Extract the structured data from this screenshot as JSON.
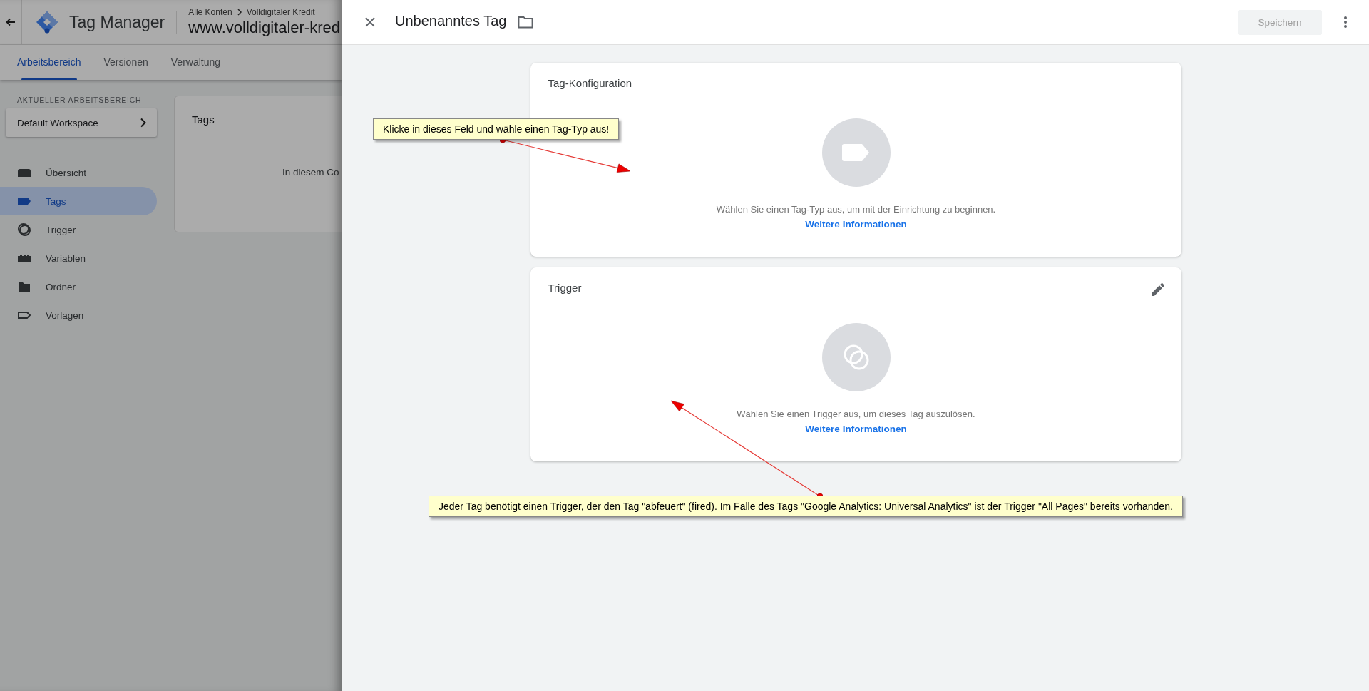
{
  "app": {
    "name": "Tag Manager",
    "breadcrumb": [
      "Alle Konten",
      "Volldigitaler Kredit"
    ],
    "container": "www.volldigitaler-kred"
  },
  "tabs": [
    {
      "label": "Arbeitsbereich",
      "selected": true
    },
    {
      "label": "Versionen",
      "selected": false
    },
    {
      "label": "Verwaltung",
      "selected": false
    }
  ],
  "workspace": {
    "heading": "AKTUELLER ARBEITSBEREICH",
    "name": "Default Workspace"
  },
  "sidebar": {
    "items": [
      {
        "label": "Übersicht",
        "kind": "overview",
        "selected": false
      },
      {
        "label": "Tags",
        "kind": "tag",
        "selected": true
      },
      {
        "label": "Trigger",
        "kind": "trigger",
        "selected": false
      },
      {
        "label": "Variablen",
        "kind": "variable",
        "selected": false
      },
      {
        "label": "Ordner",
        "kind": "folder",
        "selected": false
      },
      {
        "label": "Vorlagen",
        "kind": "template",
        "selected": false
      }
    ]
  },
  "tags_card": {
    "title": "Tags",
    "text": "In diesem Co"
  },
  "panel": {
    "title": "Unbenanntes Tag",
    "save": {
      "label": "Speichern",
      "disabled": true
    },
    "cards": [
      {
        "kind": "tag",
        "title": "Tag-Konfiguration",
        "editable": false,
        "text": "Wählen Sie einen Tag-Typ aus, um mit der Einrichtung zu beginnen.",
        "link": "Weitere Informationen"
      },
      {
        "kind": "trigger",
        "title": "Trigger",
        "editable": true,
        "text": "Wählen Sie einen Trigger aus, um dieses Tag auszulösen.",
        "link": "Weitere Informationen"
      }
    ]
  },
  "annotations": [
    "Klicke in dieses Feld und wähle einen Tag-Typ aus!",
    "Jeder Tag benötigt einen Trigger, der den Tag \"abfeuert\" (fired). Im Falle des Tags \"Google Analytics: Universal Analytics\" ist der Trigger \"All Pages\" bereits vorhanden."
  ]
}
